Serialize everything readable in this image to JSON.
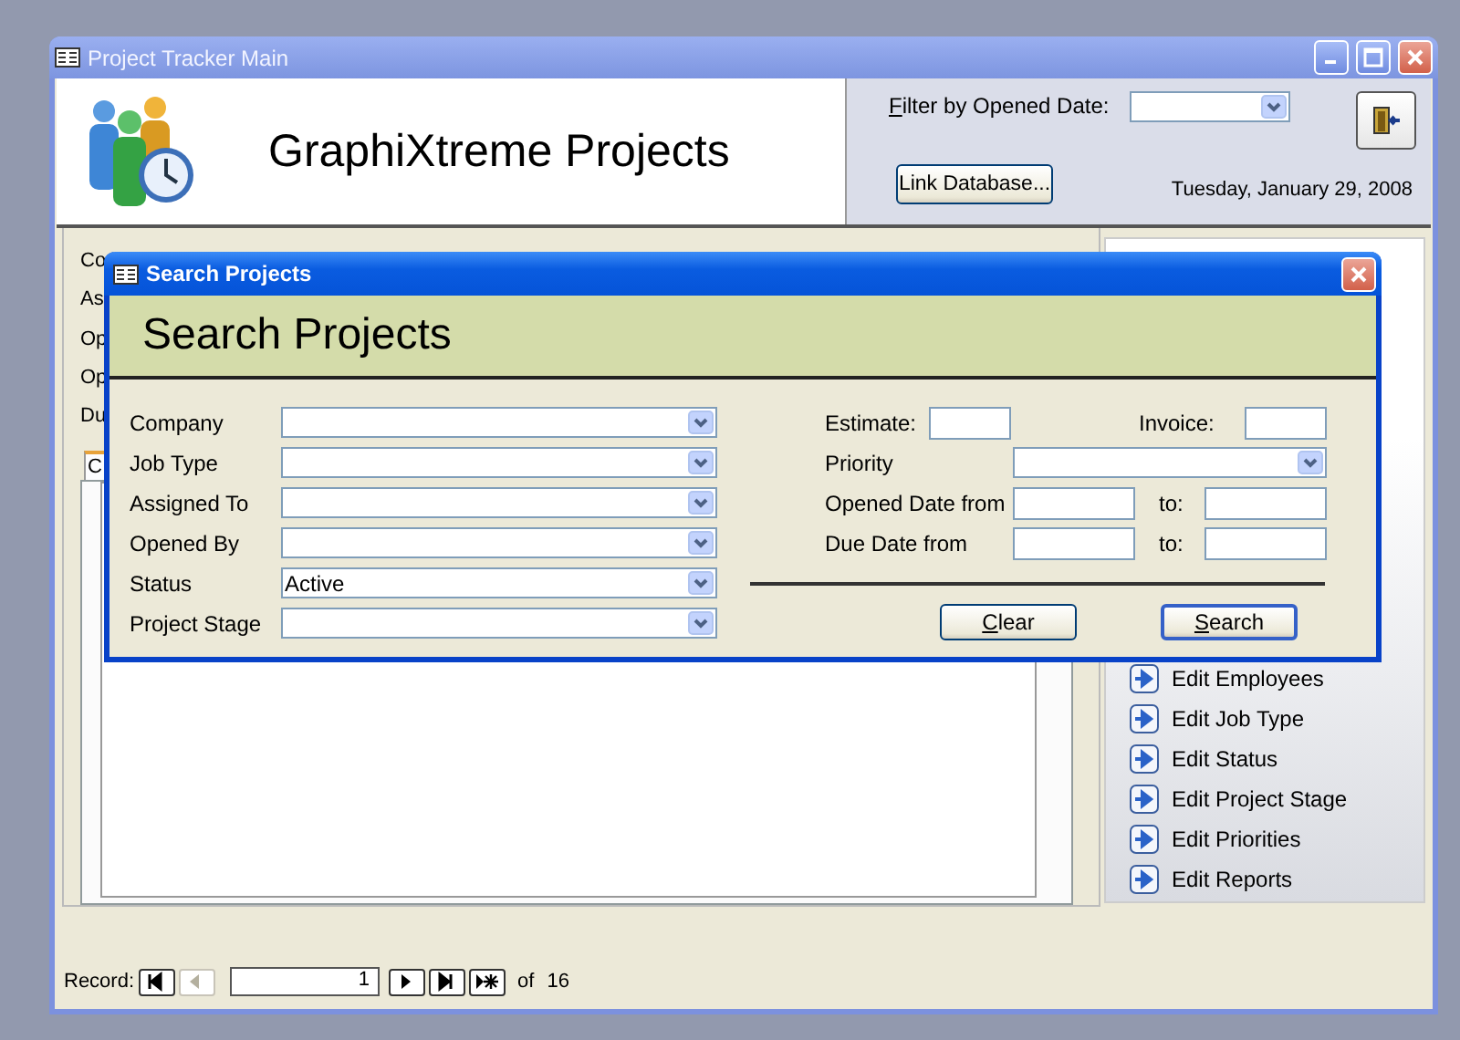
{
  "main_window": {
    "title": "Project Tracker Main",
    "app_title": "GraphiXtreme Projects",
    "filter": {
      "label": "Filter by Opened Date:",
      "first_letter_underlined": true
    },
    "link_button": "Link Database...",
    "date": "Tuesday, January 29, 2008",
    "form_labels": [
      "Co",
      "As",
      "Op",
      "Op",
      "Du"
    ],
    "tab_label": "C",
    "nav_items": [
      "Edit Employees",
      "Edit Job Type",
      "Edit Status",
      "Edit Project Stage",
      "Edit Priorities",
      "Edit Reports"
    ],
    "record_nav": {
      "label": "Record:",
      "current": "1",
      "of": "of",
      "total": "16",
      "buttons": [
        {
          "kind": "first",
          "disabled": false
        },
        {
          "kind": "previous",
          "disabled": true
        }
      ],
      "buttons_after": [
        {
          "kind": "next",
          "disabled": false
        },
        {
          "kind": "last",
          "disabled": false
        },
        {
          "kind": "new",
          "disabled": false
        }
      ]
    }
  },
  "search_dialog": {
    "title": "Search Projects",
    "heading": "Search Projects",
    "left_fields": [
      {
        "label": "Company"
      },
      {
        "label": "Job Type"
      },
      {
        "label": "Assigned To"
      },
      {
        "label": "Opened By"
      },
      {
        "label": "Status",
        "value": "Active"
      },
      {
        "label": "Project Stage"
      }
    ],
    "estimate_label": "Estimate:",
    "invoice_label": "Invoice:",
    "priority_label": "Priority",
    "ranges": [
      {
        "label": "Opened Date from",
        "to": "to:"
      },
      {
        "label": "Due Date from",
        "to": "to:"
      }
    ],
    "buttons": [
      {
        "label": "Clear",
        "first_letter_underlined": true,
        "default": false
      },
      {
        "label": "Search",
        "first_letter_underlined": true,
        "default": true
      }
    ]
  }
}
